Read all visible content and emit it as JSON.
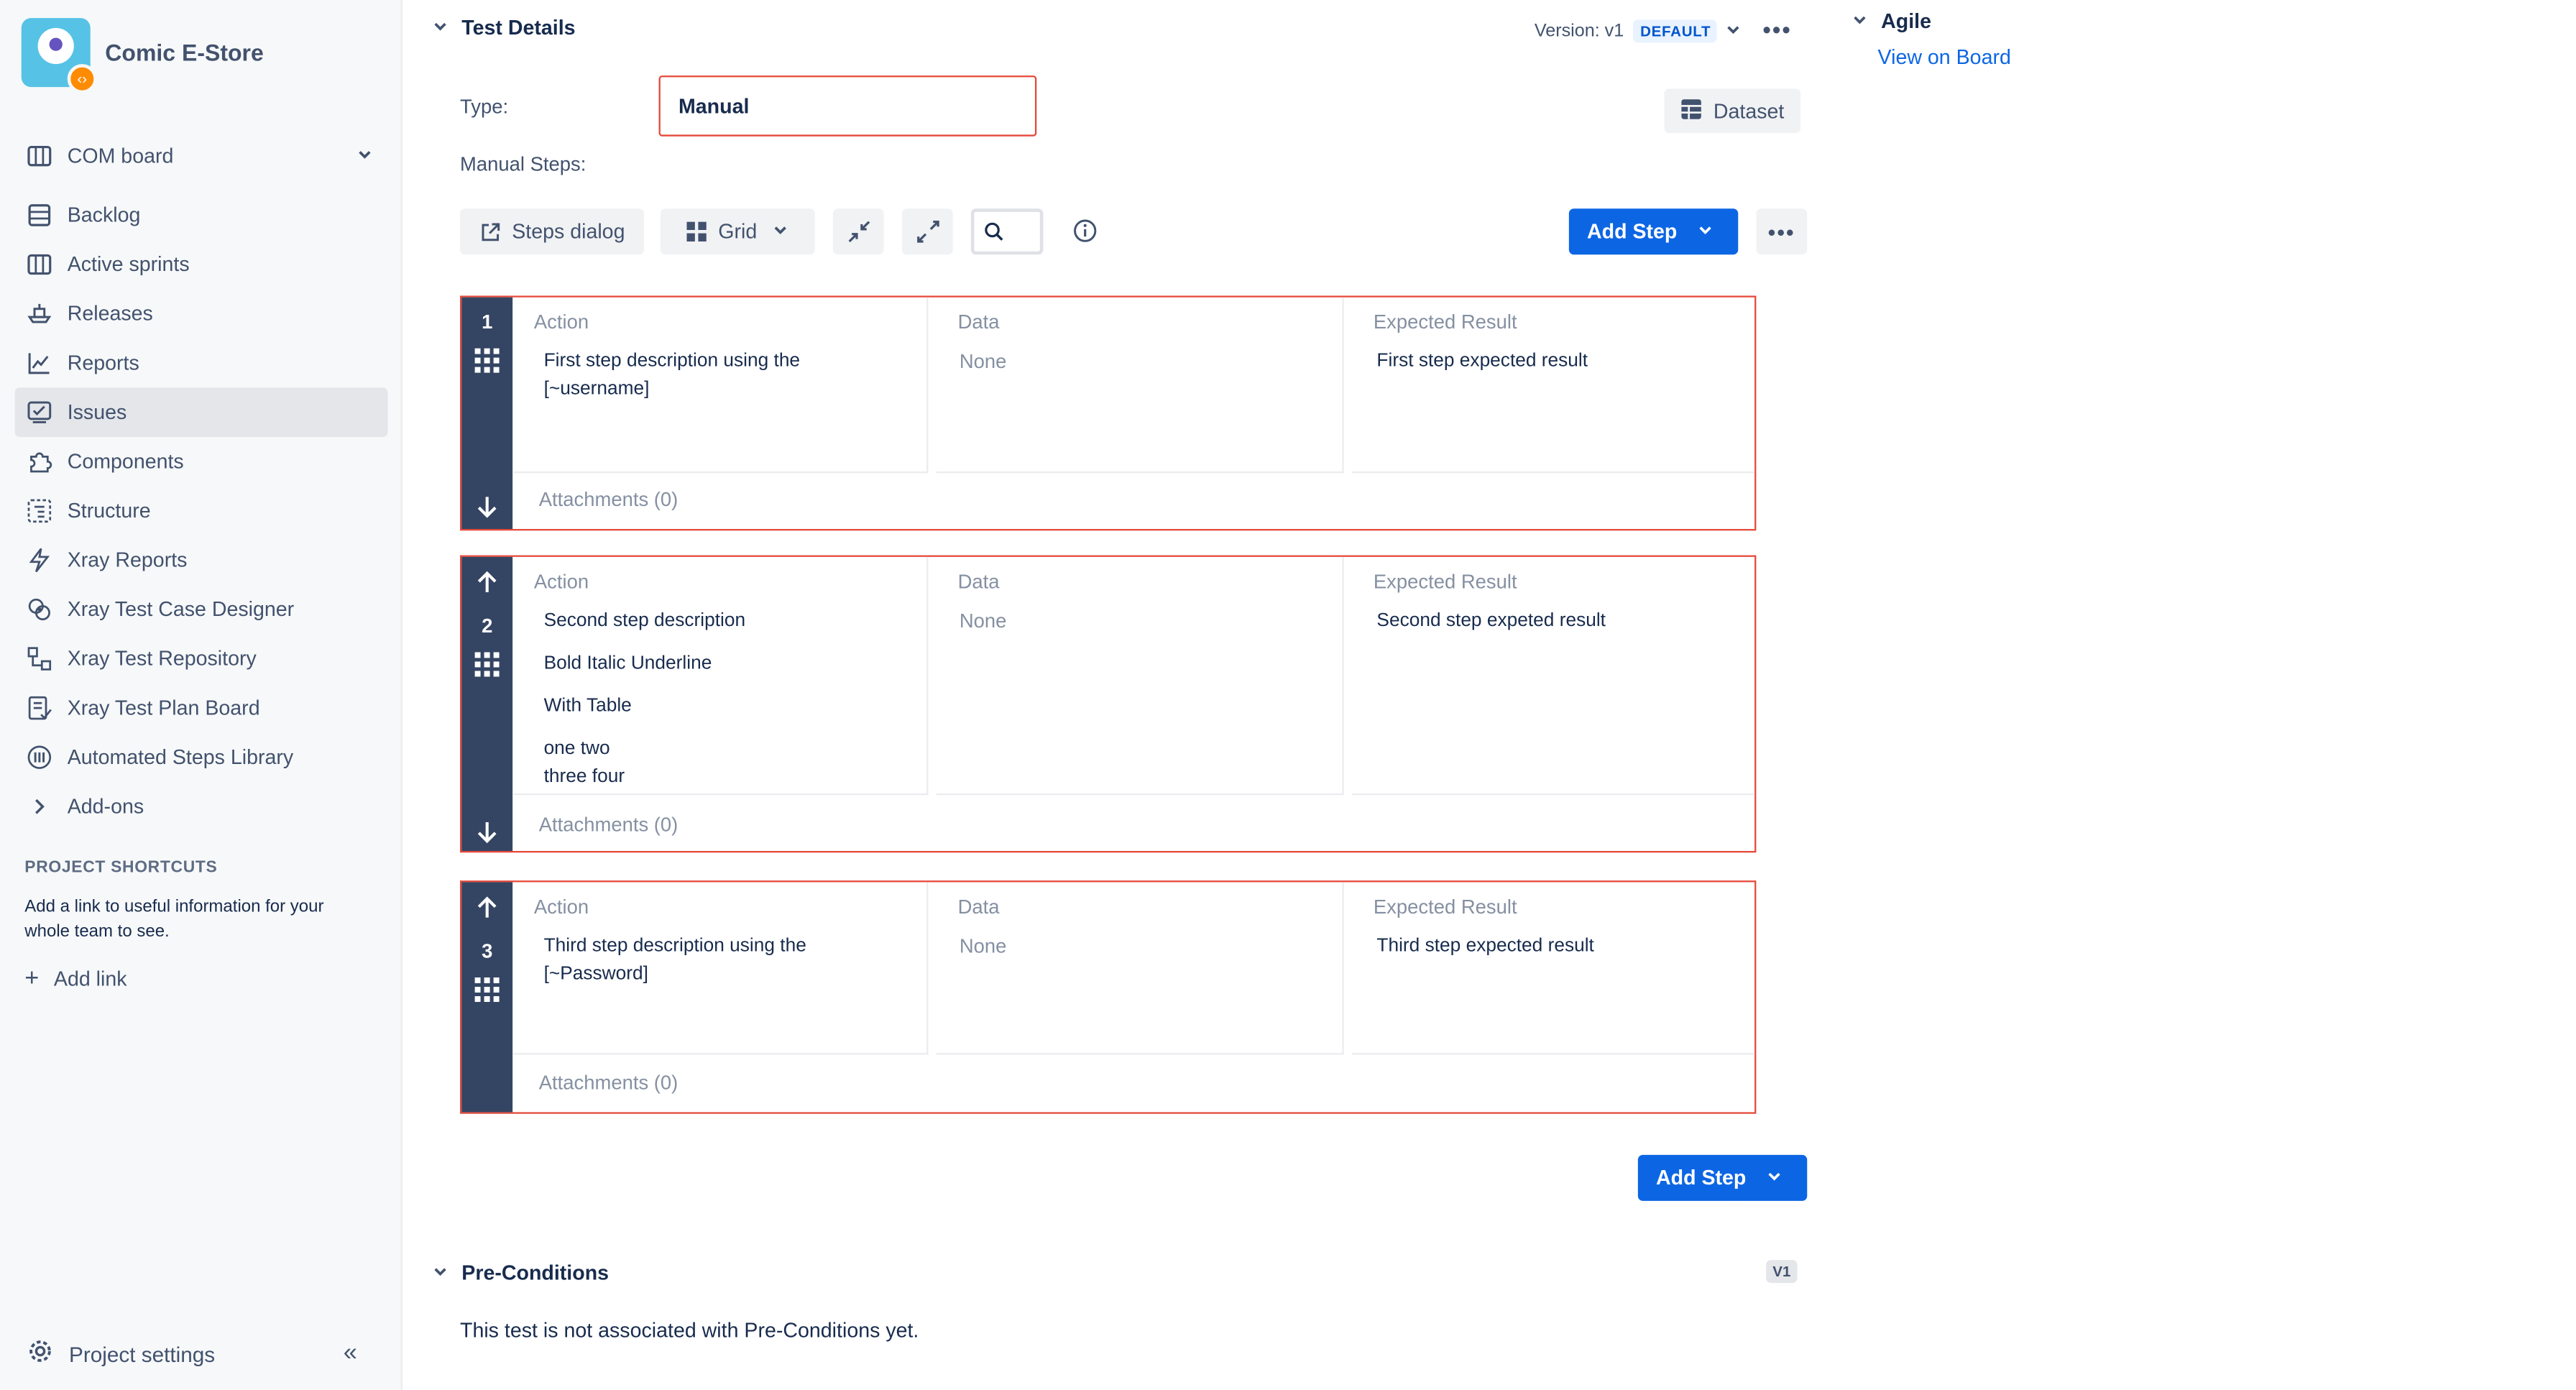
{
  "project": {
    "name": "Comic E-Store"
  },
  "sidebar": {
    "board": {
      "label": "COM board"
    },
    "items": [
      {
        "label": "Backlog",
        "icon": "backlog-icon"
      },
      {
        "label": "Active sprints",
        "icon": "board-icon"
      },
      {
        "label": "Releases",
        "icon": "ship-icon"
      },
      {
        "label": "Reports",
        "icon": "chart-icon"
      },
      {
        "label": "Issues",
        "icon": "issues-icon",
        "active": true
      },
      {
        "label": "Components",
        "icon": "puzzle-icon"
      },
      {
        "label": "Structure",
        "icon": "structure-icon"
      },
      {
        "label": "Xray Reports",
        "icon": "bolt-icon"
      },
      {
        "label": "Xray Test Case Designer",
        "icon": "brain-icon"
      },
      {
        "label": "Xray Test Repository",
        "icon": "repository-icon"
      },
      {
        "label": "Xray Test Plan Board",
        "icon": "plan-board-icon"
      },
      {
        "label": "Automated Steps Library",
        "icon": "library-icon"
      },
      {
        "label": "Add-ons",
        "icon": "chevron-right-icon"
      }
    ],
    "shortcuts_title": "PROJECT SHORTCUTS",
    "shortcuts_desc": "Add a link to useful information for your whole team to see.",
    "add_link": "Add link",
    "project_settings": "Project settings"
  },
  "test_details": {
    "title": "Test Details",
    "version_label": "Version: v1",
    "version_badge": "DEFAULT",
    "type_label": "Type:",
    "type_value": "Manual",
    "dataset_label": "Dataset",
    "manual_steps_label": "Manual Steps:",
    "toolbar": {
      "steps_dialog": "Steps dialog",
      "grid": "Grid",
      "add_step": "Add Step"
    },
    "columns": {
      "action": "Action",
      "data": "Data",
      "expected": "Expected Result"
    },
    "steps": [
      {
        "number": "1",
        "action": [
          "First step description using the [~username]"
        ],
        "data": "None",
        "expected": "First step expected result",
        "attachments": "Attachments (0)"
      },
      {
        "number": "2",
        "action": [
          "Second step description",
          "Bold Italic Underline",
          "With Table",
          "one two",
          "three four"
        ],
        "data": "None",
        "expected": "Second step expeted result",
        "attachments": "Attachments (0)"
      },
      {
        "number": "3",
        "action": [
          "Third step description using the [~Password]"
        ],
        "data": "None",
        "expected": "Third step expected result",
        "attachments": "Attachments (0)"
      }
    ],
    "add_step_bottom": "Add Step"
  },
  "preconditions": {
    "title": "Pre-Conditions",
    "badge": "V1",
    "empty_text": "This test is not associated with Pre-Conditions yet."
  },
  "agile": {
    "title": "Agile",
    "link": "View on Board"
  },
  "colors": {
    "accent": "#0C66E4",
    "highlight_border": "#E5493A",
    "rail": "#344563",
    "sidebar_bg": "#F7F8F9"
  }
}
